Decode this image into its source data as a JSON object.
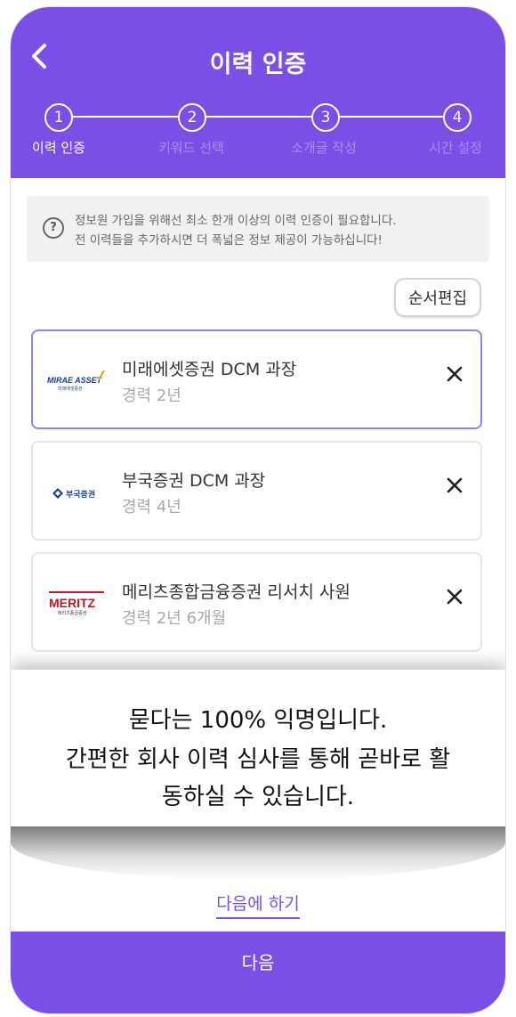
{
  "header": {
    "title": "이력 인증",
    "steps": [
      {
        "number": "1",
        "label": "이력 인증"
      },
      {
        "number": "2",
        "label": "키워드 선택"
      },
      {
        "number": "3",
        "label": "소개글 작성"
      },
      {
        "number": "4",
        "label": "시간 설정"
      }
    ]
  },
  "notice": {
    "icon": "question-circle-icon",
    "line1": "정보원 가입을 위해선 최소 한개 이상의 이력 인증이 필요합니다.",
    "line2": "전 이력들을 추가하시면 더 폭넓은 정보 제공이 가능하십니다!"
  },
  "reorder_label": "순서편집",
  "careers": [
    {
      "company": "미래에셋증권 DCM 과장",
      "experience": "경력 2년",
      "logo_text": "MIRAE ASSET",
      "logo_sub": "미래에셋증권"
    },
    {
      "company": "부국증권 DCM 과장",
      "experience": "경력 4년",
      "logo_text": "부국증권"
    },
    {
      "company": "메리츠종합금융증권 리서치 사원",
      "experience": "경력 2년 6개월",
      "logo_text": "MERITZ",
      "logo_sub": "메리츠종금증권"
    }
  ],
  "overlay": {
    "line1": "묻다는 100% 익명입니다.",
    "line2": "간편한 회사 이력 심사를 통해 곧바로 활",
    "line3": "동하실 수 있습니다."
  },
  "later_label": "다음에 하기",
  "next_label": "다음",
  "colors": {
    "accent": "#7b4fe6"
  }
}
